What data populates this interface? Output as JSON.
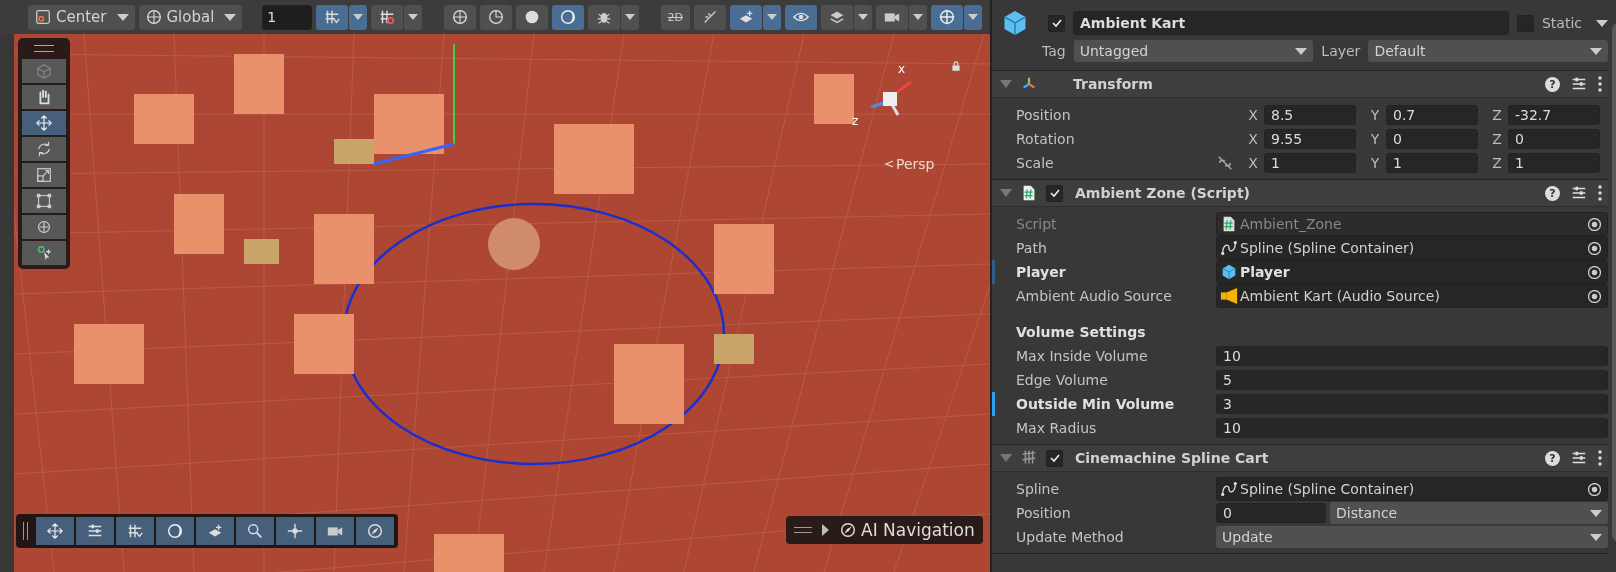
{
  "toolbar": {
    "pivot": "Center",
    "space": "Global",
    "grid_size": "1",
    "buttons": [
      {
        "kind": "grid",
        "selected": true,
        "dropdown": true
      },
      {
        "kind": "snap",
        "selected": false,
        "dropdown": true
      },
      {
        "kind": "globe",
        "selected": false,
        "dropdown": false
      },
      {
        "kind": "wire",
        "selected": false,
        "dropdown": false
      },
      {
        "kind": "solid",
        "selected": false,
        "dropdown": false
      },
      {
        "kind": "moon",
        "selected": true,
        "dropdown": false
      },
      {
        "kind": "bug",
        "selected": false,
        "dropdown": true
      },
      {
        "kind": "mode2d",
        "label": "2D",
        "selected": false,
        "dropdown": false
      },
      {
        "kind": "light",
        "selected": false,
        "dropdown": false
      },
      {
        "kind": "fx",
        "selected": true,
        "dropdown": true
      },
      {
        "kind": "eye",
        "selected": true,
        "dropdown": false
      },
      {
        "kind": "layers",
        "selected": false,
        "dropdown": true
      },
      {
        "kind": "camera",
        "selected": false,
        "dropdown": true
      },
      {
        "kind": "gizmo",
        "selected": true,
        "dropdown": true
      }
    ]
  },
  "scene": {
    "projection": "Persp",
    "gizmo_labels": [
      "x",
      "z"
    ],
    "tools": [
      {
        "kind": "view",
        "selected": false
      },
      {
        "kind": "hand",
        "selected": false
      },
      {
        "kind": "move",
        "selected": true
      },
      {
        "kind": "rotate",
        "selected": false
      },
      {
        "kind": "scale",
        "selected": false
      },
      {
        "kind": "rect",
        "selected": false
      },
      {
        "kind": "transform",
        "selected": false
      },
      {
        "kind": "custom",
        "selected": false
      }
    ],
    "overlay_tools": [
      {
        "kind": "move"
      },
      {
        "kind": "sliders"
      },
      {
        "kind": "grid"
      },
      {
        "kind": "moon"
      },
      {
        "kind": "fx"
      },
      {
        "kind": "search"
      },
      {
        "kind": "nodes"
      },
      {
        "kind": "camera"
      },
      {
        "kind": "compass"
      }
    ],
    "navigation_panel": "AI Navigation"
  },
  "inspector": {
    "object_name": "Ambient Kart",
    "active": true,
    "static": false,
    "static_label": "Static",
    "tag_label": "Tag",
    "tag": "Untagged",
    "layer_label": "Layer",
    "layer": "Default",
    "components": [
      {
        "name": "Transform",
        "kind": "transform",
        "help": "?",
        "rows": [
          {
            "label": "Position",
            "axes": [
              "X",
              "Y",
              "Z"
            ],
            "values": [
              "8.5",
              "0.7",
              "-32.7"
            ],
            "link": false
          },
          {
            "label": "Rotation",
            "axes": [
              "X",
              "Y",
              "Z"
            ],
            "values": [
              "9.55",
              "0",
              "0"
            ],
            "link": false
          },
          {
            "label": "Scale",
            "axes": [
              "X",
              "Y",
              "Z"
            ],
            "values": [
              "1",
              "1",
              "1"
            ],
            "link": true
          }
        ]
      },
      {
        "name": "Ambient Zone (Script)",
        "kind": "script",
        "enabled": true,
        "help": "?",
        "fields": [
          {
            "kind": "script",
            "label": "Script",
            "value": "Ambient_Zone",
            "disabled": true,
            "modified": false
          },
          {
            "kind": "spline",
            "label": "Path",
            "value": "Spline (Spline Container)",
            "disabled": false,
            "modified": false
          },
          {
            "kind": "gameobject",
            "label": "Player",
            "value": "Player",
            "disabled": false,
            "modified": true
          },
          {
            "kind": "audiosource",
            "label": "Ambient Audio Source",
            "value": "Ambient Kart (Audio Source)",
            "disabled": false,
            "modified": false
          },
          {
            "kind": "header",
            "label": "Volume Settings"
          },
          {
            "kind": "number",
            "label": "Max Inside Volume",
            "value": "10",
            "modified": false
          },
          {
            "kind": "number",
            "label": "Edge Volume",
            "value": "5",
            "modified": false
          },
          {
            "kind": "number",
            "label": "Outside Min Volume",
            "value": "3",
            "modified": true
          },
          {
            "kind": "number",
            "label": "Max Radius",
            "value": "10",
            "modified": false
          }
        ]
      },
      {
        "name": "Cinemachine Spline Cart",
        "kind": "cart",
        "enabled": true,
        "help": "?",
        "fields": [
          {
            "kind": "spline",
            "label": "Spline",
            "value": "Spline (Spline Container)",
            "disabled": false,
            "modified": false
          },
          {
            "kind": "number_dropdown",
            "label": "Position",
            "value": "0",
            "option": "Distance",
            "modified": false
          },
          {
            "kind": "dropdown",
            "label": "Update Method",
            "value": "Update",
            "modified": false
          }
        ]
      }
    ]
  }
}
